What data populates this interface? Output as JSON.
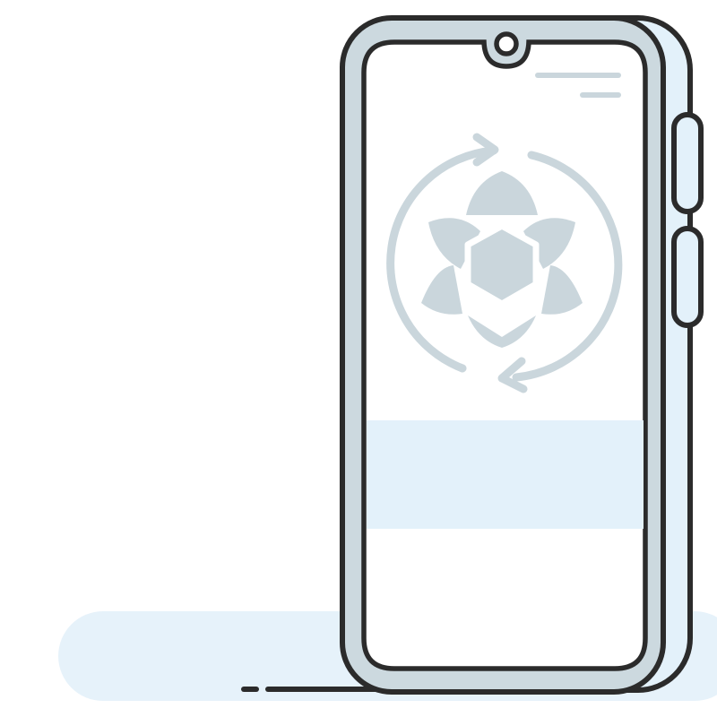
{
  "colors": {
    "background": "#ffffff",
    "floor_shadow": "#e6f2fa",
    "outline": "#2b2b2b",
    "frame_fill": "#ccd9df",
    "side_fill": "#e3f1fa",
    "screen_fill": "#ffffff",
    "icon_fill": "#cad6dc",
    "banner_fill": "#e3f1fa"
  },
  "icons": {
    "screen_symbol": "sync-lotus-icon",
    "status_lines": "status-lines-icon",
    "camera": "front-camera-icon"
  }
}
